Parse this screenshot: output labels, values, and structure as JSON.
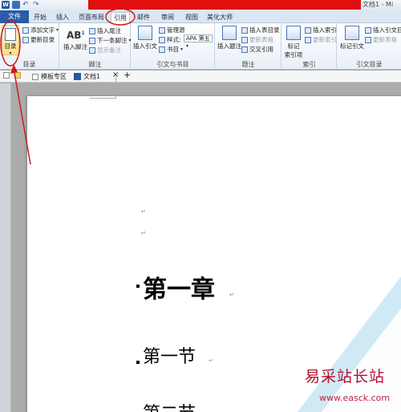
{
  "titlebar": {
    "title": "文档1 - Mi"
  },
  "tabs": [
    {
      "label": "文件"
    },
    {
      "label": "开始"
    },
    {
      "label": "插入"
    },
    {
      "label": "页面布局"
    },
    {
      "label": "引用"
    },
    {
      "label": "邮件"
    },
    {
      "label": "审阅"
    },
    {
      "label": "视图"
    },
    {
      "label": "美化大师"
    }
  ],
  "ribbon": {
    "toc": {
      "big_label": "目录",
      "add_text": "添加文字",
      "update_toc": "更新目录",
      "group": "目录"
    },
    "footnotes": {
      "insert_footnote": "插入脚注",
      "insert_endnote": "插入尾注",
      "next_footnote": "下一条脚注",
      "show_notes": "显示备注",
      "group": "脚注"
    },
    "citations": {
      "insert_citation": "插入引文",
      "manage_sources": "管理源",
      "style_label": "样式:",
      "style_value": "APA 第五",
      "bibliography": "书目",
      "group": "引文与书目"
    },
    "captions": {
      "insert_caption": "插入题注",
      "insert_table_of_figures": "插入表目录",
      "update_table": "更新表格",
      "cross_reference": "交叉引用",
      "group": "题注"
    },
    "index": {
      "mark_entry_line1": "标记",
      "mark_entry_line2": "索引项",
      "insert_index": "插入索引",
      "update_index": "更新索引",
      "group": "索引"
    },
    "toa": {
      "mark_citation": "标记引文",
      "insert_toa": "插入引文目",
      "update_table": "更新表格",
      "group": "引文目录"
    }
  },
  "doctabs": {
    "template_tab": "模板专区",
    "doc_tab": "文档1",
    "close": "×",
    "add": "+"
  },
  "document": {
    "heading1": "第一章",
    "heading2": "第一节",
    "heading3": "第二节",
    "para_mark": "↵"
  },
  "watermark": {
    "text": "易采站长站",
    "url": "www.easck.com"
  },
  "colors": {
    "accent_red": "#e01010",
    "file_tab": "#2a5ca8",
    "annotation": "#d11a1a"
  }
}
